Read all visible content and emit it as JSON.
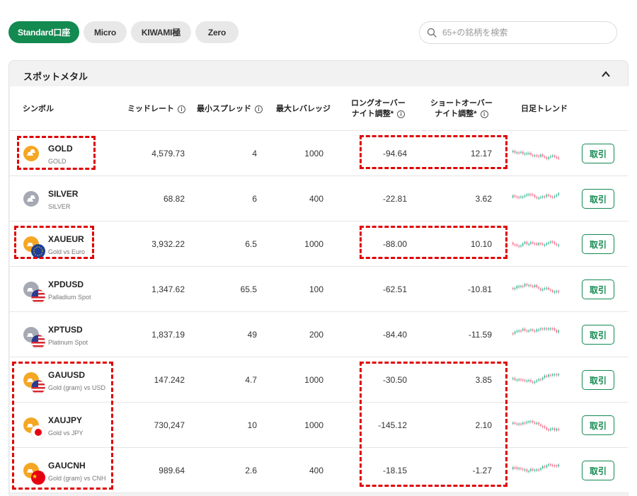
{
  "tabs": [
    {
      "label": "Standard口座",
      "active": true
    },
    {
      "label": "Micro",
      "active": false
    },
    {
      "label": "KIWAMI極",
      "active": false
    },
    {
      "label": "Zero",
      "active": false
    }
  ],
  "search": {
    "placeholder": "65+の銘柄を検索"
  },
  "section": {
    "title": "スポットメタル"
  },
  "columns": {
    "symbol": "シンボル",
    "mid": "ミッドレート",
    "spread": "最小スプレッド",
    "leverage": "最大レバレッジ",
    "long_l1": "ロングオーバー",
    "long_l2": "ナイト調整*",
    "short_l1": "ショートオーバー",
    "short_l2": "ナイト調整*",
    "trend": "日足トレンド"
  },
  "info_glyph": "i",
  "trade_label": "取引",
  "colors": {
    "accent": "#138a50",
    "highlight": "#e00000",
    "trend_up": "#2bb28e",
    "trend_down": "#f06580"
  },
  "rows": [
    {
      "symbol": "GOLD",
      "desc": "GOLD",
      "mid": "4,579.73",
      "spread": "4",
      "leverage": "1000",
      "long": "-94.64",
      "short": "12.17",
      "icon": "gold-bar-icon"
    },
    {
      "symbol": "SILVER",
      "desc": "SILVER",
      "mid": "68.82",
      "spread": "6",
      "leverage": "400",
      "long": "-22.81",
      "short": "3.62",
      "icon": "silver-bar-icon"
    },
    {
      "symbol": "XAUEUR",
      "desc": "Gold vs Euro",
      "mid": "3,932.22",
      "spread": "6.5",
      "leverage": "1000",
      "long": "-88.00",
      "short": "10.10",
      "icon": "gold-euro-flag-icon"
    },
    {
      "symbol": "XPDUSD",
      "desc": "Palladium Spot",
      "mid": "1,347.62",
      "spread": "65.5",
      "leverage": "100",
      "long": "-62.51",
      "short": "-10.81",
      "icon": "palladium-us-flag-icon"
    },
    {
      "symbol": "XPTUSD",
      "desc": "Platinum Spot",
      "mid": "1,837.19",
      "spread": "49",
      "leverage": "200",
      "long": "-84.40",
      "short": "-11.59",
      "icon": "platinum-us-flag-icon"
    },
    {
      "symbol": "GAUUSD",
      "desc": "Gold (gram) vs USD",
      "mid": "147.242",
      "spread": "4.7",
      "leverage": "1000",
      "long": "-30.50",
      "short": "3.85",
      "icon": "gold-us-flag-icon"
    },
    {
      "symbol": "XAUJPY",
      "desc": "Gold vs JPY",
      "mid": "730,247",
      "spread": "10",
      "leverage": "1000",
      "long": "-145.12",
      "short": "2.10",
      "icon": "gold-japan-flag-icon"
    },
    {
      "symbol": "GAUCNH",
      "desc": "Gold (gram) vs CNH",
      "mid": "989.64",
      "spread": "2.6",
      "leverage": "400",
      "long": "-18.15",
      "short": "-1.27",
      "icon": "gold-china-flag-icon"
    }
  ]
}
